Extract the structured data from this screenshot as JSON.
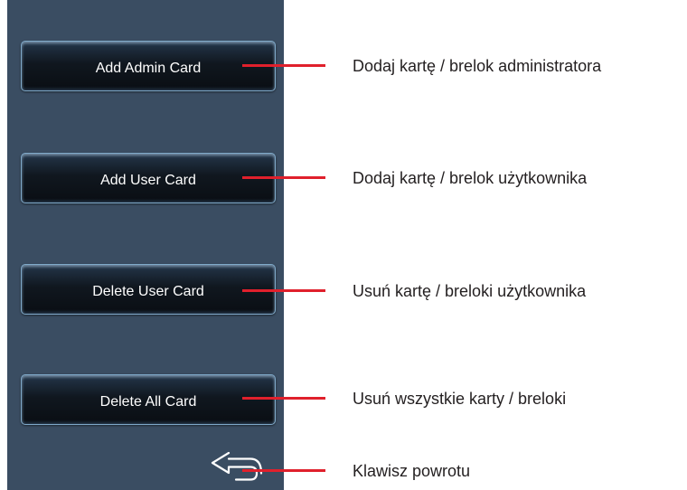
{
  "menu": {
    "buttons": [
      {
        "label": "Add Admin Card"
      },
      {
        "label": "Add User Card"
      },
      {
        "label": "Delete User Card"
      },
      {
        "label": "Delete All Card"
      }
    ],
    "back_key": {
      "icon": "return-arrow-icon"
    }
  },
  "callouts": [
    {
      "text": "Dodaj kartę / brelok administratora"
    },
    {
      "text": "Dodaj kartę / brelok użytkownika"
    },
    {
      "text": "Usuń kartę / breloki użytkownika"
    },
    {
      "text": "Usuń wszystkie karty / breloki"
    },
    {
      "text": "Klawisz powrotu"
    }
  ],
  "colors": {
    "panel_background": "#3a4d62",
    "button_border": "#7fa9c9",
    "leader_line": "#e0202c",
    "label_text": "#231f20"
  }
}
